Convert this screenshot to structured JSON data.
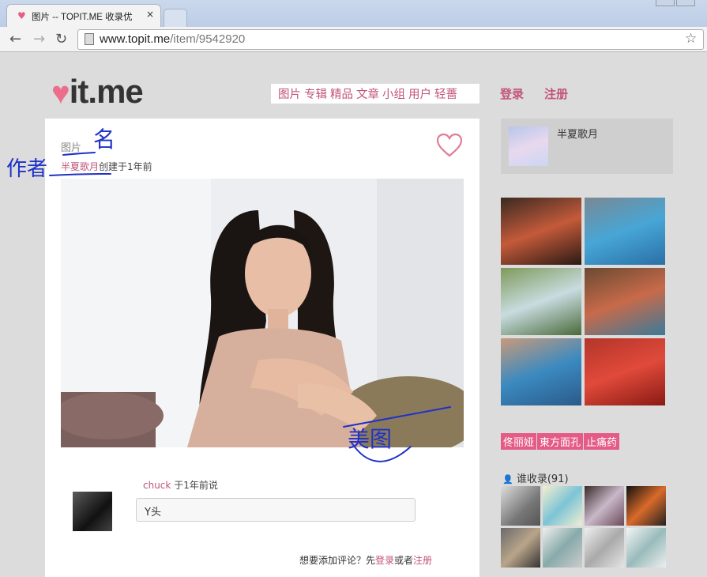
{
  "browser": {
    "tab_title": "图片 -- TOPIT.ME 收录优",
    "tab_close": "×",
    "url_host": "www.topit.me",
    "url_path": "/item/9542920"
  },
  "site": {
    "logo_text": "it.me",
    "nav": [
      "图片",
      "专辑",
      "精品",
      "文章",
      "小组",
      "用户",
      "轻薔"
    ],
    "login": "登录",
    "register": "注册"
  },
  "item": {
    "breadcrumb": "图片",
    "author_name": "半夏歌月",
    "created_text": "创建于1年前",
    "comment_user": "chuck",
    "comment_time": "于1年前说",
    "comment_text": "Y头",
    "add_comment_prefix": "想要添加评论？先",
    "add_comment_login": "登录",
    "add_comment_or": "或者",
    "add_comment_register": "注册"
  },
  "sidebar": {
    "user_name": "半夏歌月",
    "tags": [
      "佟丽娅",
      "東方面孔",
      "止痛药"
    ],
    "collectors_label": "谁收录(91)"
  },
  "annotations": {
    "name_mark": "名",
    "author_mark": "作者",
    "beauty_mark": "美图"
  },
  "colors": {
    "accent": "#c2537b",
    "tag_bg": "#e45b85",
    "ink": "#1f31c8"
  }
}
